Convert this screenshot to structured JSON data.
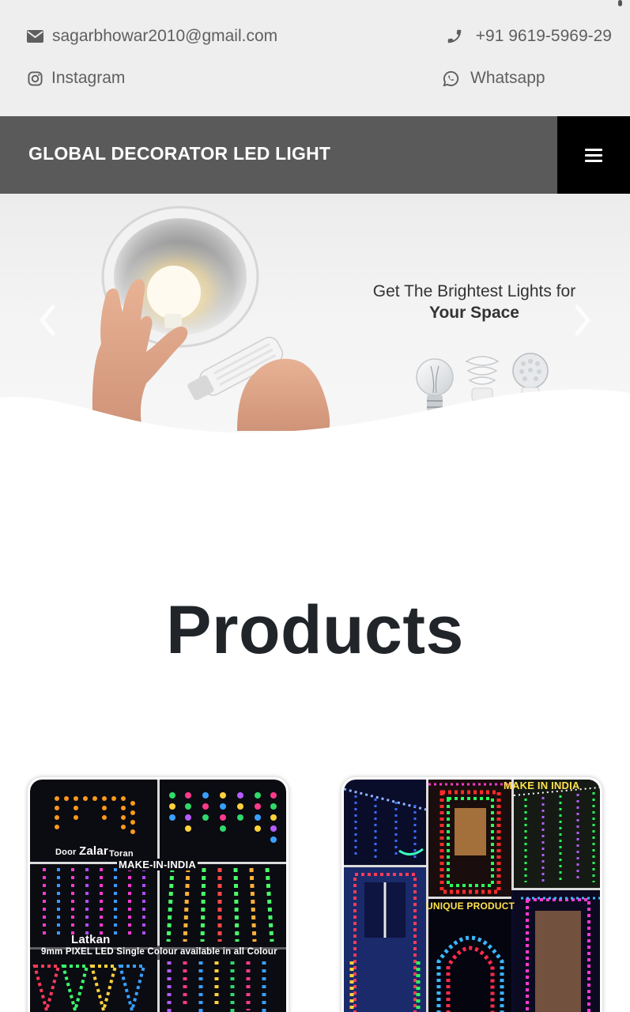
{
  "contact": {
    "email": "sagarbhowar2010@gmail.com",
    "phone": "+91 9619-5969-29",
    "instagram": "Instagram",
    "whatsapp": "Whatsapp",
    "icons": {
      "email": "envelope-icon",
      "phone": "phone-icon",
      "instagram": "instagram-icon",
      "whatsapp": "whatsapp-icon"
    }
  },
  "navbar": {
    "brand": "GLOBAL DECORATOR LED LIGHT",
    "menu_icon": "hamburger-menu-icon"
  },
  "hero": {
    "line1": "Get The Brightest Lights for",
    "line2": "Your Space",
    "prev_icon": "chevron-left-icon",
    "next_icon": "chevron-right-icon"
  },
  "products": {
    "title": "Products",
    "cards": [
      {
        "captions": {
          "door": "Door",
          "zalar": "Zalar",
          "toran": "Toran",
          "make": "MAKE-IN-INDIA",
          "latkan": "Latkan",
          "pixel": "9mm PIXEL LED Single Colour available in all Colour"
        }
      },
      {
        "captions": {
          "make": "MAKE IN INDIA",
          "unique": "UNIQUE PRODUCT"
        }
      }
    ]
  },
  "colors": {
    "topbar_bg": "#eeeeee",
    "navbar_bg": "#5a5a5a",
    "menu_bg": "#000000",
    "text_muted": "#5f5f5f",
    "heading": "#212529"
  }
}
